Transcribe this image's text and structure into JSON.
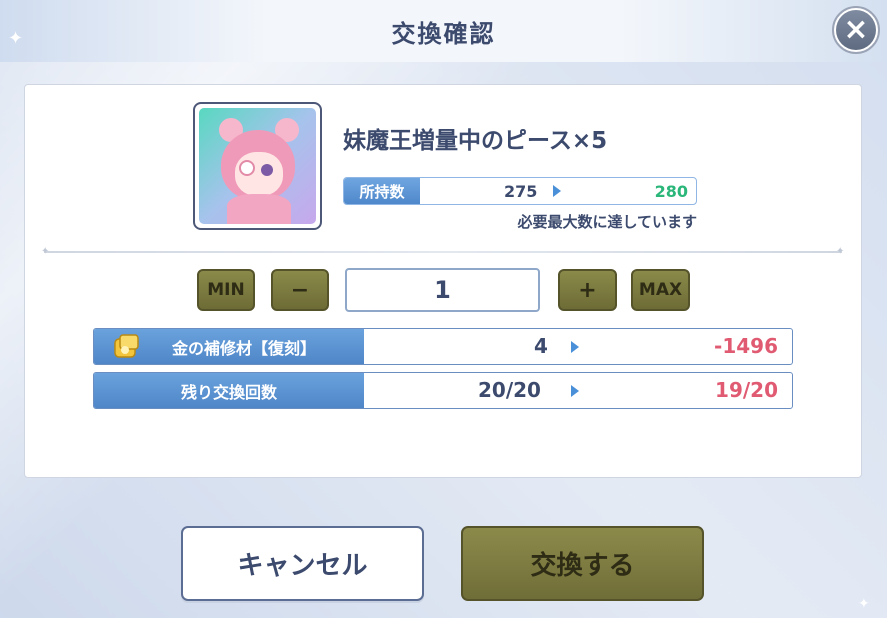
{
  "dialog": {
    "title": "交換確認",
    "close_icon": "close-icon"
  },
  "item": {
    "name": "妹魔王増量中のピース×5",
    "owned_label": "所持数",
    "owned_current": "275",
    "owned_after": "280",
    "max_note": "必要最大数に達しています"
  },
  "quantity": {
    "min_label": "MIN",
    "minus_label": "−",
    "value": "1",
    "plus_label": "+",
    "max_label": "MAX"
  },
  "costs": [
    {
      "label": "金の補修材【復刻】",
      "current": "4",
      "after": "-1496",
      "icon": "gold-material-icon"
    },
    {
      "label": "残り交換回数",
      "current": "20/20",
      "after": "19/20"
    }
  ],
  "actions": {
    "cancel_label": "キャンセル",
    "confirm_label": "交換する"
  },
  "colors": {
    "accent_blue": "#4f86c8",
    "owned_after": "#2bb67a",
    "negative": "#e05a72",
    "olive_button": "#706e38"
  }
}
